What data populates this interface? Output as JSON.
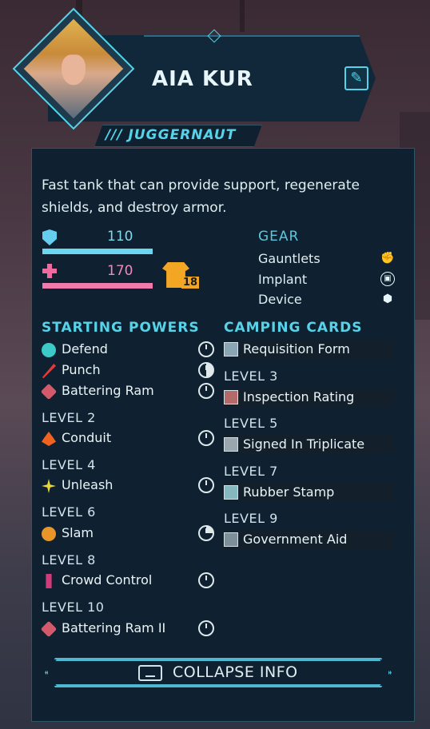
{
  "character": {
    "name": "AIA KUR",
    "class_name": "/// JUGGERNAUT"
  },
  "description": "Fast tank that can provide support, regenerate shields, and destroy armor.",
  "stats": {
    "shield": "110",
    "health": "170",
    "armor": "18"
  },
  "gear": {
    "title": "GEAR",
    "items": [
      {
        "label": "Gauntlets",
        "icon": "gauntlet-icon"
      },
      {
        "label": "Implant",
        "icon": "implant-icon"
      },
      {
        "label": "Device",
        "icon": "device-icon"
      }
    ]
  },
  "powers": {
    "title": "STARTING POWERS",
    "starting": [
      {
        "label": "Defend",
        "icon": "defend-icon",
        "color": "#3ec9c9"
      },
      {
        "label": "Punch",
        "icon": "punch-icon",
        "color": "#e03a3a"
      },
      {
        "label": "Battering Ram",
        "icon": "battering-ram-icon",
        "color": "#d25a6a"
      }
    ],
    "levels": [
      {
        "level": "LEVEL 2",
        "label": "Conduit",
        "icon": "conduit-icon",
        "color": "#f0621e"
      },
      {
        "level": "LEVEL 4",
        "label": "Unleash",
        "icon": "unleash-icon",
        "color": "#e8d83a"
      },
      {
        "level": "LEVEL 6",
        "label": "Slam",
        "icon": "slam-icon",
        "color": "#e8962a"
      },
      {
        "level": "LEVEL 8",
        "label": "Crowd Control",
        "icon": "crowd-control-icon",
        "color": "#d23a7a"
      },
      {
        "level": "LEVEL 10",
        "label": "Battering Ram II",
        "icon": "battering-ram-icon",
        "color": "#d25a6a"
      }
    ]
  },
  "camping": {
    "title": "CAMPING CARDS",
    "starting": {
      "label": "Requisition Form",
      "icon": "card-icon"
    },
    "levels": [
      {
        "level": "LEVEL 3",
        "label": "Inspection Rating",
        "icon": "card-icon"
      },
      {
        "level": "LEVEL 5",
        "label": "Signed In Triplicate",
        "icon": "card-icon"
      },
      {
        "level": "LEVEL 7",
        "label": "Rubber Stamp",
        "icon": "card-icon"
      },
      {
        "level": "LEVEL 9",
        "label": "Government Aid",
        "icon": "card-icon"
      }
    ]
  },
  "collapse": {
    "label": "COLLAPSE INFO"
  }
}
